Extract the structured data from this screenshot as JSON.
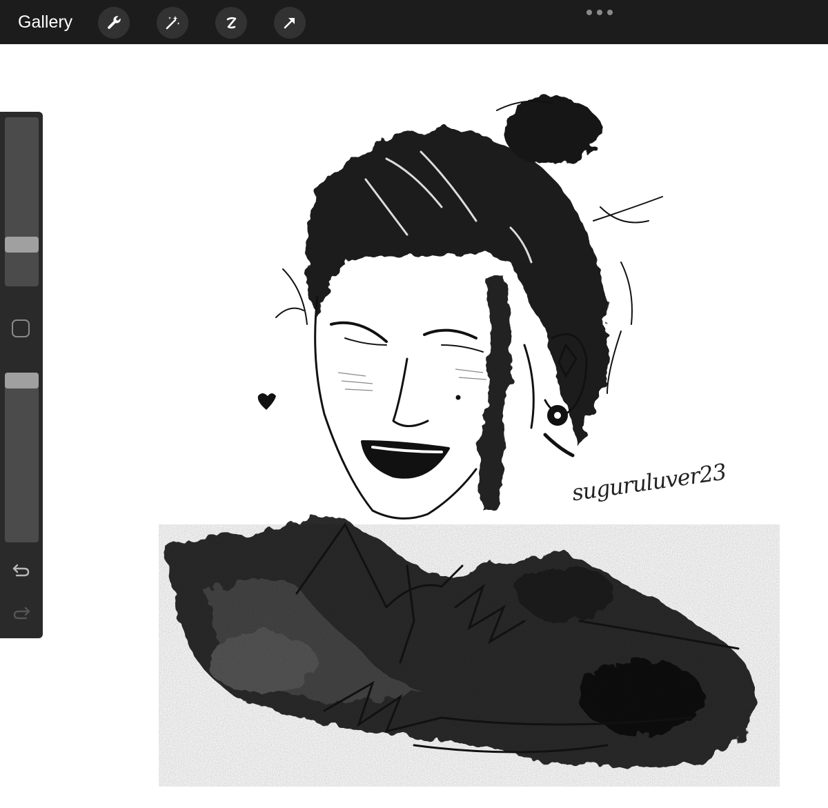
{
  "topbar": {
    "gallery_label": "Gallery",
    "tools": [
      {
        "icon": "wrench-icon",
        "action": "actions"
      },
      {
        "icon": "magic-wand-icon",
        "action": "adjustments"
      },
      {
        "icon": "selection-icon",
        "action": "selection"
      },
      {
        "icon": "transform-arrow-icon",
        "action": "transform"
      }
    ],
    "more_icon": "ellipsis-icon"
  },
  "sidebar": {
    "brush_size_level": 0.25,
    "opacity_level": 1.0,
    "modify_icon": "square-modify-icon",
    "undo_icon": "undo-arrow-icon",
    "redo_icon": "redo-arrow-icon"
  },
  "canvas": {
    "signature": "suguruluver23",
    "colors": {
      "ink": "#111111",
      "paper": "#ffffff"
    }
  }
}
